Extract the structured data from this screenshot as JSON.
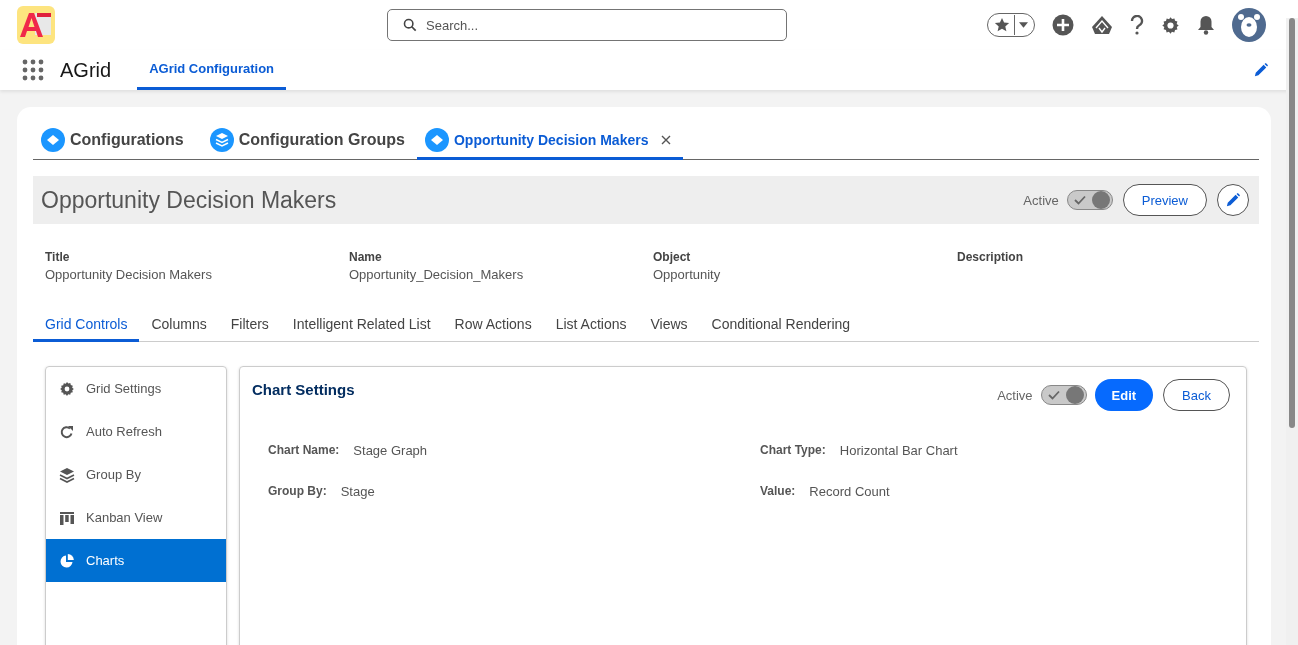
{
  "header": {
    "search": {
      "placeholder": "Search..."
    }
  },
  "nav": {
    "app_name": "AGrid",
    "tabs": [
      {
        "label": "AGrid Configuration",
        "selected": true
      }
    ]
  },
  "workspace_tabs": [
    {
      "label": "Configurations",
      "kind": "object",
      "selected": false,
      "closable": false
    },
    {
      "label": "Configuration Groups",
      "kind": "group",
      "selected": false,
      "closable": false
    },
    {
      "label": "Opportunity Decision Makers",
      "kind": "object",
      "selected": true,
      "closable": true
    }
  ],
  "record": {
    "title": "Opportunity Decision Makers",
    "status_label": "Active",
    "on": true,
    "button": "Preview"
  },
  "fields": [
    {
      "label": "Title",
      "value": "Opportunity Decision Makers"
    },
    {
      "label": "Name",
      "value": "Opportunity_Decision_Makers"
    },
    {
      "label": "Object",
      "value": "Opportunity"
    },
    {
      "label": "Description"
    }
  ],
  "subtabs": [
    {
      "label": "Grid Controls",
      "selected": true
    },
    {
      "label": "Columns",
      "selected": false
    },
    {
      "label": "Filters",
      "selected": false
    },
    {
      "label": "Intelligent Related List",
      "selected": false
    },
    {
      "label": "Row Actions",
      "selected": false
    },
    {
      "label": "List Actions",
      "selected": false
    },
    {
      "label": "Views",
      "selected": false
    },
    {
      "label": "Conditional Rendering",
      "selected": false
    }
  ],
  "sidebar": {
    "items": [
      {
        "label": "Grid Settings",
        "kind": "gear",
        "selected": false
      },
      {
        "label": "Auto Refresh",
        "kind": "refresh",
        "selected": false
      },
      {
        "label": "Group By",
        "kind": "layers",
        "selected": false
      },
      {
        "label": "Kanban View",
        "kind": "kanban",
        "selected": false
      },
      {
        "label": "Charts",
        "kind": "pie",
        "selected": true
      }
    ]
  },
  "panel": {
    "title": "Chart Settings",
    "status_label": "Active",
    "on": true,
    "buttons": [
      {
        "label": "Edit",
        "kind": "primary"
      },
      {
        "label": "Back",
        "kind": "outline"
      }
    ],
    "fields": [
      {
        "label": "Chart Name:",
        "value": "Stage Graph"
      },
      {
        "label": "Chart Type:",
        "value": "Horizontal Bar Chart"
      },
      {
        "label": "Group By:",
        "value": "Stage"
      },
      {
        "label": "Value:",
        "value": "Record Count"
      }
    ]
  }
}
